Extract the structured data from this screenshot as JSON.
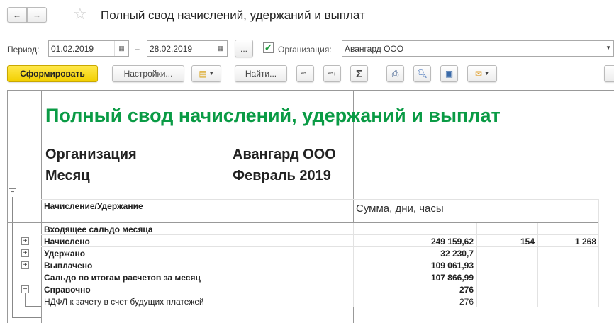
{
  "window": {
    "title": "Полный свод начислений, удержаний и выплат"
  },
  "filters": {
    "period_label": "Период:",
    "date_from": "01.02.2019",
    "dash": "–",
    "date_to": "28.02.2019",
    "more_label": "...",
    "org_checked": true,
    "org_label": "Организация:",
    "org_value": "Авангард ООО"
  },
  "toolbar": {
    "generate": "Сформировать",
    "settings": "Настройки...",
    "find": "Найти...",
    "sum": "Σ"
  },
  "report": {
    "title": "Полный свод начислений, удержаний и выплат",
    "org_label": "Организация",
    "org_value": "Авангард ООО",
    "month_label": "Месяц",
    "month_value": "Февраль 2019",
    "col_name": "Начисление/Удержание",
    "col_sum": "Сумма, дни, часы",
    "rows": [
      {
        "name": "Входящее сальдо месяца",
        "sum": "",
        "days": "",
        "hours": ""
      },
      {
        "name": "Начислено",
        "sum": "249 159,62",
        "days": "154",
        "hours": "1 268"
      },
      {
        "name": "Удержано",
        "sum": "32 230,7",
        "days": "",
        "hours": ""
      },
      {
        "name": "Выплачено",
        "sum": "109 061,93",
        "days": "",
        "hours": ""
      },
      {
        "name": "Сальдо по итогам расчетов за месяц",
        "sum": "107 866,99",
        "days": "",
        "hours": ""
      },
      {
        "name": "Справочно",
        "sum": "276",
        "days": "",
        "hours": ""
      },
      {
        "name": "НДФЛ к зачету в счет будущих платежей",
        "sum": "276",
        "days": "",
        "hours": ""
      }
    ]
  },
  "colors": {
    "accent": "#f5d90a",
    "title_green": "#0a9b45"
  }
}
